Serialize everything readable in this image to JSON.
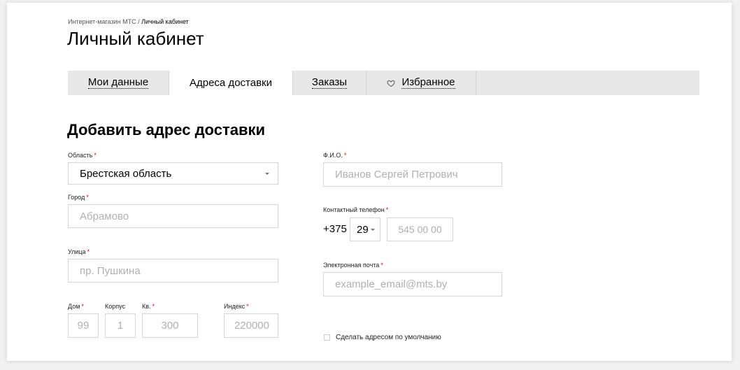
{
  "breadcrumb": {
    "parent": "Интернет-магазин МТС",
    "separator": " / ",
    "current": "Личный кабинет"
  },
  "page_title": "Личный кабинет",
  "tabs": [
    {
      "label": "Мои данные",
      "active": false
    },
    {
      "label": "Адреса доставки",
      "active": true
    },
    {
      "label": "Заказы",
      "active": false
    },
    {
      "label": "Избранное",
      "active": false,
      "icon": "heart-outline-icon"
    }
  ],
  "section_title": "Добавить адрес доставки",
  "required_mark": "*",
  "form": {
    "region": {
      "label": "Область",
      "value": "Брестская область"
    },
    "city": {
      "label": "Город",
      "placeholder": "Абрамово"
    },
    "street": {
      "label": "Улица",
      "placeholder": "пр. Пушкина"
    },
    "house": {
      "label": "Дом",
      "placeholder": "99"
    },
    "building": {
      "label": "Корпус",
      "placeholder": "1"
    },
    "apartment": {
      "label": "Кв.",
      "placeholder": "300"
    },
    "postcode": {
      "label": "Индекс",
      "placeholder": "220000"
    },
    "full_name": {
      "label": "Ф.И.О.",
      "placeholder": "Иванов Сергей Петрович"
    },
    "phone": {
      "label": "Контактный телефон",
      "country_code": "+375",
      "operator_code": "29",
      "number_placeholder": "545 00 00"
    },
    "email": {
      "label": "Электронная почта",
      "placeholder": "example_email@mts.by"
    },
    "default_address": {
      "label": "Сделать адресом по умолчанию",
      "checked": false
    }
  },
  "colors": {
    "required": "#e30611",
    "tabs_background": "#e8e8e8",
    "active_tab": "#ffffff",
    "page_background": "#f1f1f1"
  }
}
